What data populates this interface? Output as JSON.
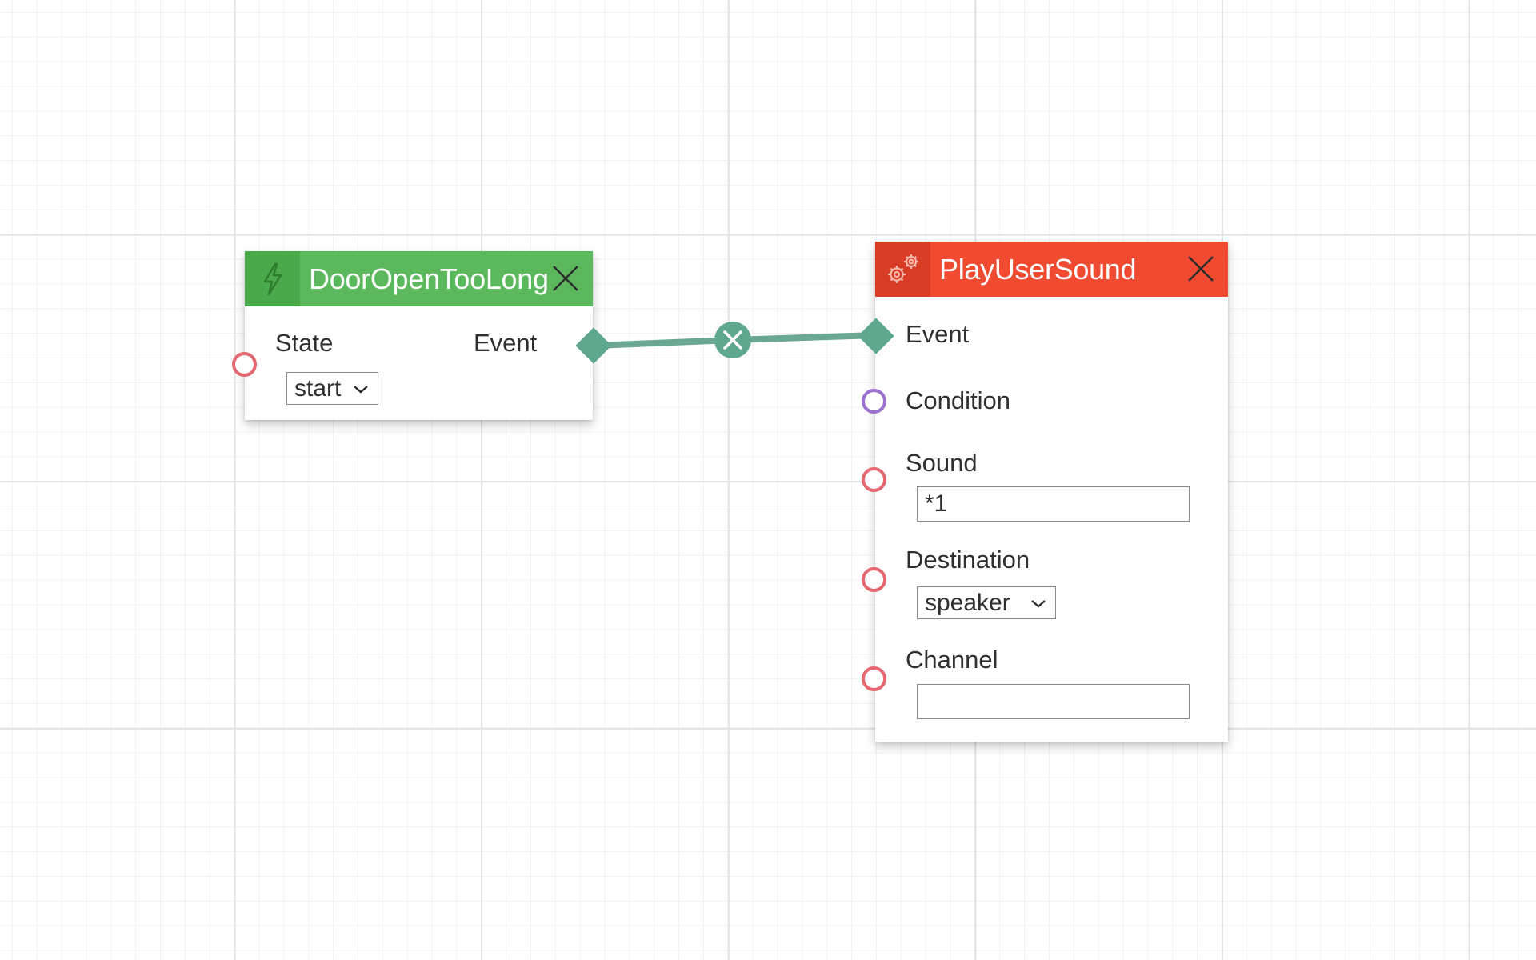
{
  "colors": {
    "trigger_header": "#5cb85c",
    "trigger_icon_box": "#4aa94a",
    "action_header": "#f04a30",
    "action_icon_box": "#d93c25",
    "event_port": "#5fa88e",
    "input_port": "#e5676f",
    "condition_port": "#9b70cf",
    "connection": "#6aa891"
  },
  "trigger_node": {
    "icon": "lightning-icon",
    "title": "DoorOpenTooLong",
    "close_icon": "close-icon",
    "state_label": "State",
    "state_value": "start",
    "event_label": "Event"
  },
  "connection": {
    "delete_icon": "delete-connection-icon"
  },
  "action_node": {
    "icon": "gears-icon",
    "title": "PlayUserSound",
    "close_icon": "close-icon",
    "event_label": "Event",
    "condition_label": "Condition",
    "sound_label": "Sound",
    "sound_value": "*1",
    "destination_label": "Destination",
    "destination_value": "speaker",
    "channel_label": "Channel",
    "channel_value": ""
  }
}
